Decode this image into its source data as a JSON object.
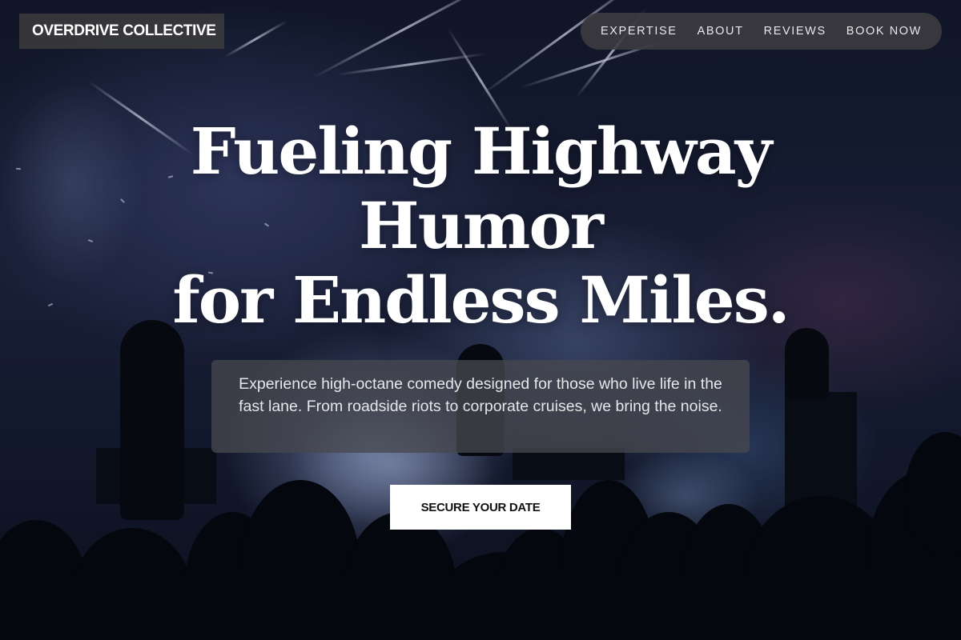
{
  "brand": {
    "name": "OVERDRIVE COLLECTIVE"
  },
  "nav": {
    "items": [
      {
        "label": "EXPERTISE"
      },
      {
        "label": "ABOUT"
      },
      {
        "label": "REVIEWS"
      },
      {
        "label": "BOOK NOW"
      }
    ]
  },
  "hero": {
    "headline_lines": [
      "Fueling Highway",
      "Humor",
      "for Endless Miles."
    ],
    "subtext": "Experience high-octane comedy designed for those who live life in the fast lane. From roadside riots to corporate cruises, we bring the noise.",
    "cta_label": "SECURE YOUR DATE",
    "background_image": "concert-crowd-stage-lights-photo"
  },
  "colors": {
    "cta_background": "#ffffff",
    "cta_text": "#111111",
    "nav_background": "#3c3c40",
    "brand_background": "#3a3a3c",
    "headline": "#ffffff"
  }
}
